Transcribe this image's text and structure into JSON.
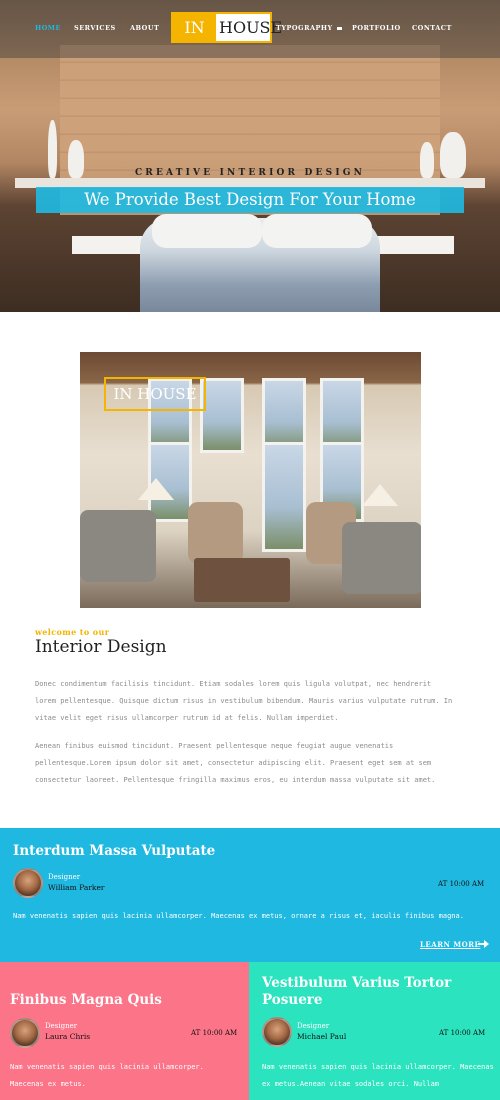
{
  "nav": {
    "items": [
      "HOME",
      "SERVICES",
      "ABOUT",
      "TYPOGRAPHY",
      "PORTFOLIO",
      "CONTACT"
    ],
    "active_color": "#1fb8e0"
  },
  "logo": {
    "part1": "IN",
    "part2": "HOUSE",
    "accent": "#f4b400"
  },
  "hero": {
    "subtitle": "CREATIVE INTERIOR DESIGN",
    "title": "We Provide Best Design For Your Home"
  },
  "about": {
    "photo_logo": "IN HOUSE",
    "welcome": "welcome to our",
    "title": "Interior Design",
    "paragraphs": [
      "Donec condimentum facilisis tincidunt. Etiam sodales lorem quis ligula volutpat, nec hendrerit lorem pellentesque. Quisque dictum risus in vestibulum bibendum. Mauris varius vulputate rutrum. In vitae velit eget risus ullamcorper rutrum id at felis. Nullam imperdiet.",
      "Aenean finibus euismod tincidunt. Praesent pellentesque neque feugiat augue venenatis pellentesque.Lorem ipsum dolor sit amet, consectetur adipiscing elit. Praesent eget sem at sem consectetur laoreet. Pellentesque fringilla maximus eros, eu interdum massa vulputate sit amet."
    ]
  },
  "cards": [
    {
      "title": "Interdum Massa Vulputate",
      "role": "Designer",
      "author": "William Parker",
      "time": "AT 10:00 AM",
      "text": "Nam venenatis sapien quis lacinia ullamcorper. Maecenas ex metus, ornare a risus et, iaculis finibus magna.",
      "more": "LEARN MORE",
      "color": "#1fb8e0"
    },
    {
      "title": "Finibus Magna Quis",
      "role": "Designer",
      "author": "Laura Chris",
      "time": "AT 10:00 AM",
      "text": "Nam venenatis sapien quis lacinia ullamcorper. Maecenas ex metus.",
      "color": "#fb7488"
    },
    {
      "title": "Vestibulum Varius Tortor Posuere",
      "role": "Designer",
      "author": "Michael Paul",
      "time": "AT 10:00 AM",
      "text": "Nam venenatis sapien quis lacinia ullamcorper. Maecenas ex metus.Aenean vitae sodales orci. Nullam",
      "color": "#2ce3bf"
    }
  ]
}
